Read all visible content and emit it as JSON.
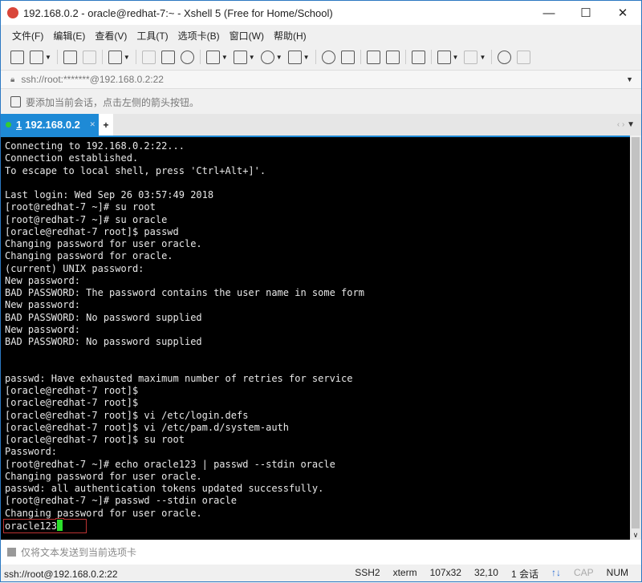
{
  "window": {
    "title": "192.168.0.2 - oracle@redhat-7:~ - Xshell 5 (Free for Home/School)",
    "minimize": "—",
    "maximize": "☐",
    "close": "✕"
  },
  "menu": [
    "文件(F)",
    "编辑(E)",
    "查看(V)",
    "工具(T)",
    "选项卡(B)",
    "窗口(W)",
    "帮助(H)"
  ],
  "address": {
    "value": "ssh://root:*******@192.168.0.2:22"
  },
  "hint": "要添加当前会话，点击左侧的箭头按钮。",
  "tabs": [
    {
      "index": "1",
      "label": "192.168.0.2"
    }
  ],
  "terminal": {
    "lines": [
      "Connecting to 192.168.0.2:22...",
      "Connection established.",
      "To escape to local shell, press 'Ctrl+Alt+]'.",
      "",
      "Last login: Wed Sep 26 03:57:49 2018",
      "[root@redhat-7 ~]# su root",
      "[root@redhat-7 ~]# su oracle",
      "[oracle@redhat-7 root]$ passwd",
      "Changing password for user oracle.",
      "Changing password for oracle.",
      "(current) UNIX password:",
      "New password:",
      "BAD PASSWORD: The password contains the user name in some form",
      "New password:",
      "BAD PASSWORD: No password supplied",
      "New password:",
      "BAD PASSWORD: No password supplied",
      "",
      "",
      "passwd: Have exhausted maximum number of retries for service",
      "[oracle@redhat-7 root]$",
      "[oracle@redhat-7 root]$",
      "[oracle@redhat-7 root]$ vi /etc/login.defs",
      "[oracle@redhat-7 root]$ vi /etc/pam.d/system-auth",
      "[oracle@redhat-7 root]$ su root",
      "Password:",
      "[root@redhat-7 ~]# echo oracle123 | passwd --stdin oracle",
      "Changing password for user oracle.",
      "passwd: all authentication tokens updated successfully.",
      "[root@redhat-7 ~]# passwd --stdin oracle",
      "Changing password for user oracle."
    ],
    "input": "oracle123"
  },
  "send_bar": "仅将文本发送到当前选项卡",
  "status": {
    "connection": "ssh://root@192.168.0.2:22",
    "protocol": "SSH2",
    "term": "xterm",
    "size": "107x32",
    "cursor": "32,10",
    "sessions": "1 会话",
    "cap": "CAP",
    "num": "NUM"
  }
}
